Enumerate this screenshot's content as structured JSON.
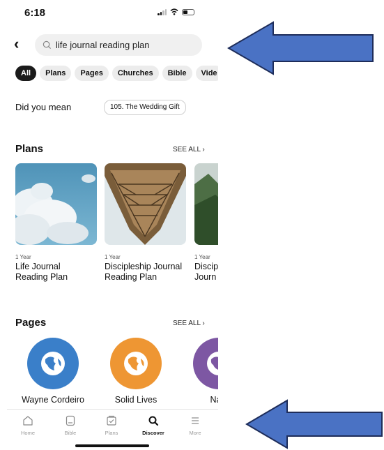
{
  "status_bar": {
    "time": "6:18"
  },
  "search": {
    "query": "life journal reading plan"
  },
  "filters": [
    "All",
    "Plans",
    "Pages",
    "Churches",
    "Bible",
    "Vide"
  ],
  "did_you_mean": {
    "label": "Did you mean",
    "suggestion": "105. The Wedding Gift"
  },
  "plans_section": {
    "title": "Plans",
    "see_all": "SEE ALL ›",
    "items": [
      {
        "duration": "1 Year",
        "title": "Life Journal Reading Plan",
        "line1": "Life Journal",
        "line2": "Reading Plan"
      },
      {
        "duration": "1 Year",
        "title": "Discipleship Journal Reading Plan",
        "line1": "Discipleship Journal",
        "line2": "Reading Plan"
      },
      {
        "duration": "1 Year",
        "title": "Disciple Journ",
        "line1": "Discip",
        "line2": "Journ"
      }
    ]
  },
  "pages_section": {
    "title": "Pages",
    "see_all": "SEE ALL ›",
    "items": [
      {
        "name": "Wayne Cordeiro",
        "color": "#3a7fc9",
        "icon": "globe-logo-icon"
      },
      {
        "name": "Solid Lives",
        "color": "#ee9633",
        "icon": "globe-logo-icon"
      },
      {
        "name": "Navi",
        "color": "#7d57a3",
        "icon": "globe-logo-icon"
      }
    ]
  },
  "tab_bar": [
    {
      "label": "Home",
      "icon": "home-icon"
    },
    {
      "label": "Bible",
      "icon": "bible-icon"
    },
    {
      "label": "Plans",
      "icon": "plans-icon"
    },
    {
      "label": "Discover",
      "icon": "search-icon",
      "active": true
    },
    {
      "label": "More",
      "icon": "menu-icon"
    }
  ],
  "annotation_color": "#4a72c4"
}
